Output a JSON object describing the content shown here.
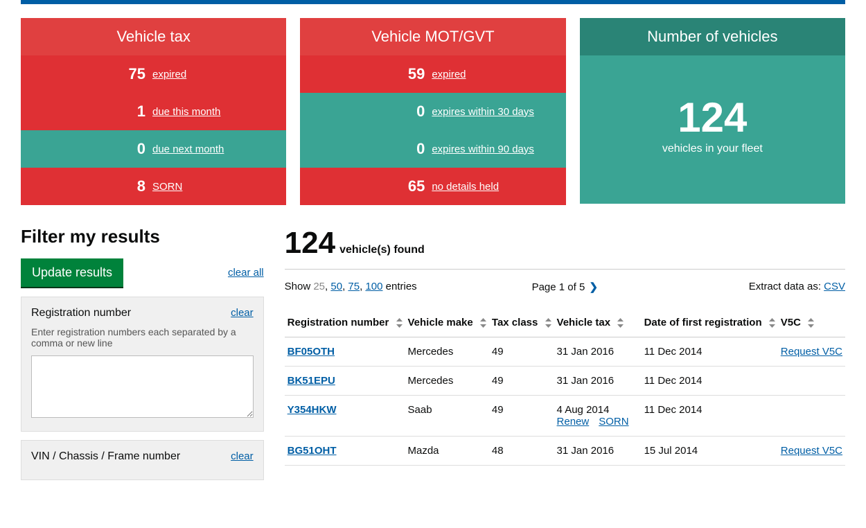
{
  "cards": {
    "tax": {
      "title": "Vehicle tax",
      "rows": [
        {
          "num": "75",
          "label": "expired",
          "bg": "red"
        },
        {
          "num": "1",
          "label": "due this month",
          "bg": "red"
        },
        {
          "num": "0",
          "label": "due next month",
          "bg": "teal"
        },
        {
          "num": "8",
          "label": "SORN",
          "bg": "red"
        }
      ]
    },
    "mot": {
      "title": "Vehicle MOT/GVT",
      "rows": [
        {
          "num": "59",
          "label": "expired",
          "bg": "red"
        },
        {
          "num": "0",
          "label": "expires within 30 days",
          "bg": "teal"
        },
        {
          "num": "0",
          "label": "expires within 90 days",
          "bg": "teal"
        },
        {
          "num": "65",
          "label": "no details held",
          "bg": "red"
        }
      ]
    },
    "fleet": {
      "title": "Number of vehicles",
      "num": "124",
      "label": "vehicles in your fleet"
    }
  },
  "filter": {
    "heading": "Filter my results",
    "update": "Update results",
    "clear_all": "clear all",
    "reg": {
      "title": "Registration number",
      "clear": "clear",
      "help": "Enter registration numbers each separated by a comma or new line"
    },
    "vin": {
      "title": "VIN / Chassis / Frame number",
      "clear": "clear"
    }
  },
  "results": {
    "count": "124",
    "count_label": "vehicle(s) found",
    "show_label": "Show",
    "show_entries": [
      "25",
      "50",
      "75",
      "100"
    ],
    "show_suffix": "entries",
    "page_label": "Page 1 of 5",
    "extract_label": "Extract data as:",
    "extract_link": "CSV",
    "columns": [
      "Registration number",
      "Vehicle make",
      "Tax class",
      "Vehicle tax",
      "Date of first registration",
      "V5C"
    ],
    "rows": [
      {
        "reg": "BF05OTH",
        "make": "Mercedes",
        "tax_class": "49",
        "tax": "31 Jan 2016",
        "actions": [],
        "dofr": "11 Dec 2014",
        "v5c": "Request V5C"
      },
      {
        "reg": "BK51EPU",
        "make": "Mercedes",
        "tax_class": "49",
        "tax": "31 Jan 2016",
        "actions": [],
        "dofr": "11 Dec 2014",
        "v5c": ""
      },
      {
        "reg": "Y354HKW",
        "make": "Saab",
        "tax_class": "49",
        "tax": "4 Aug 2014",
        "actions": [
          "Renew",
          "SORN"
        ],
        "dofr": "11 Dec 2014",
        "v5c": ""
      },
      {
        "reg": "BG51OHT",
        "make": "Mazda",
        "tax_class": "48",
        "tax": "31 Jan 2016",
        "actions": [],
        "dofr": "15 Jul 2014",
        "v5c": "Request V5C"
      }
    ]
  }
}
